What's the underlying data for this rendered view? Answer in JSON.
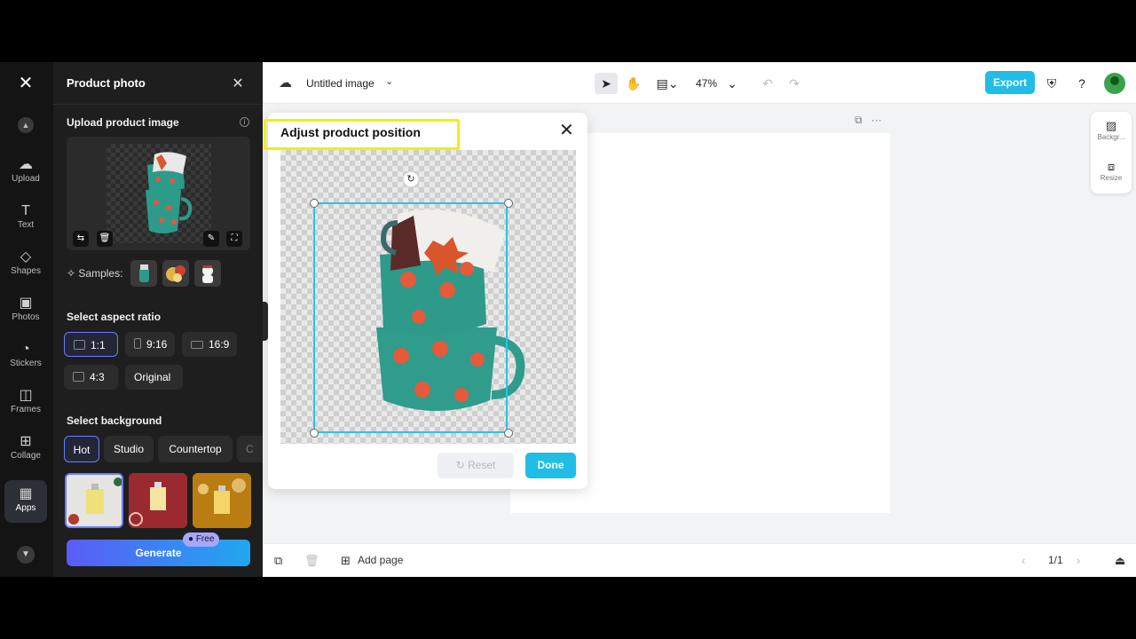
{
  "app": {
    "logo": "capcut-logo"
  },
  "rail": {
    "items": [
      {
        "label": "Upload",
        "icon": "cloud-upload-icon",
        "glyph": "☁"
      },
      {
        "label": "Text",
        "icon": "text-icon",
        "glyph": "T"
      },
      {
        "label": "Shapes",
        "icon": "shapes-icon",
        "glyph": "◇"
      },
      {
        "label": "Photos",
        "icon": "photos-icon",
        "glyph": "▣"
      },
      {
        "label": "Stickers",
        "icon": "stickers-icon",
        "glyph": "◔"
      },
      {
        "label": "Frames",
        "icon": "frames-icon",
        "glyph": "◫"
      },
      {
        "label": "Collage",
        "icon": "collage-icon",
        "glyph": "⊞"
      },
      {
        "label": "Apps",
        "icon": "apps-icon",
        "glyph": "▦"
      }
    ]
  },
  "panel": {
    "title": "Product photo",
    "upload_label": "Upload product image",
    "samples_label": "Samples:",
    "aspect_label": "Select aspect ratio",
    "aspect_options": [
      "1:1",
      "9:16",
      "16:9",
      "4:3",
      "Original"
    ],
    "aspect_selected": "1:1",
    "background_label": "Select background",
    "background_tags": [
      "Hot",
      "Studio",
      "Countertop",
      "C"
    ],
    "background_selected": "Hot",
    "generate_label": "Generate",
    "free_badge": "Free"
  },
  "topbar": {
    "doc_title": "Untitled image",
    "zoom": "47%",
    "export_label": "Export"
  },
  "right_tools": {
    "background": "Backgr...",
    "resize": "Resize"
  },
  "bottombar": {
    "add_page": "Add page",
    "page_indicator": "1/1"
  },
  "dialog": {
    "title": "Adjust product position",
    "reset_label": "Reset",
    "done_label": "Done"
  },
  "colors": {
    "accent": "#20bde6",
    "highlight": "#f3ee10",
    "selected_chip": "#6b7cff"
  }
}
